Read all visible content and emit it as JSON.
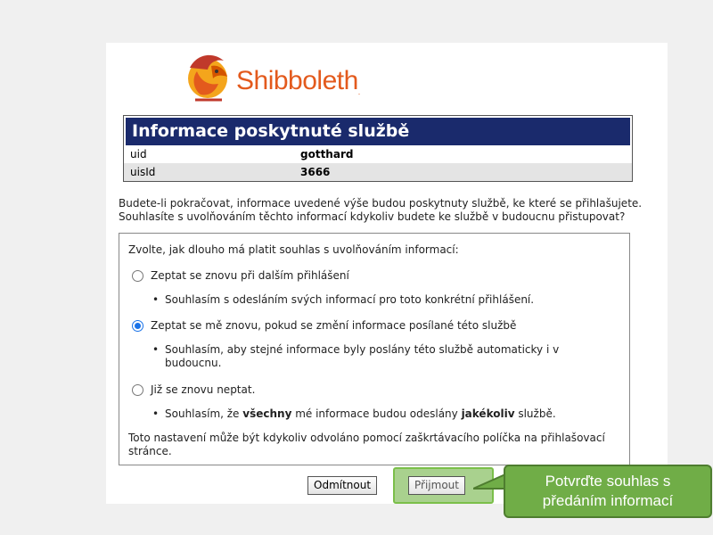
{
  "logo": {
    "brand": "Shibboleth",
    "mark": "."
  },
  "info": {
    "title": "Informace poskytnuté službě",
    "rows": [
      {
        "key": "uid",
        "value": "gotthard"
      },
      {
        "key": "uisId",
        "value": "3666"
      }
    ]
  },
  "intro_text": "Budete-li pokračovat, informace uvedené výše budou poskytnuty službě, ke které se přihlašujete. Souhlasíte s uvolňováním těchto informací kdykoliv budete ke službě v budoucnu přistupovat?",
  "consent": {
    "heading": "Zvolte, jak dlouho má platit souhlas s uvolňováním informací:",
    "options": [
      {
        "label": "Zeptat se znovu při dalším přihlášení",
        "selected": false,
        "detail": "Souhlasím s odesláním svých informací pro toto konkrétní přihlášení."
      },
      {
        "label": "Zeptat se mě znovu, pokud se změní informace posílané této službě",
        "selected": true,
        "detail": "Souhlasím, aby stejné informace byly poslány této službě automaticky i v budoucnu."
      },
      {
        "label": "Již se znovu neptat.",
        "selected": false,
        "detail_parts": [
          "Souhlasím, že ",
          "všechny",
          " mé informace budou odeslány ",
          "jakékoliv",
          " službě."
        ]
      }
    ],
    "footnote": "Toto nastavení může být kdykoliv odvoláno pomocí zaškrtávacího políčka na přihlašovací stránce."
  },
  "buttons": {
    "reject": "Odmítnout",
    "accept": "Přijmout"
  },
  "callout": {
    "line1": "Potvrďte souhlas s",
    "line2": "předáním informací"
  },
  "colors": {
    "header_bg": "#1a2a6c",
    "brand_orange": "#e35a1d",
    "callout_green": "#70ad47",
    "accept_highlight": "#a9d18e",
    "radio_selected": "#1a73e8"
  },
  "icons": {
    "logo_icon": "griffin-logo-icon"
  }
}
